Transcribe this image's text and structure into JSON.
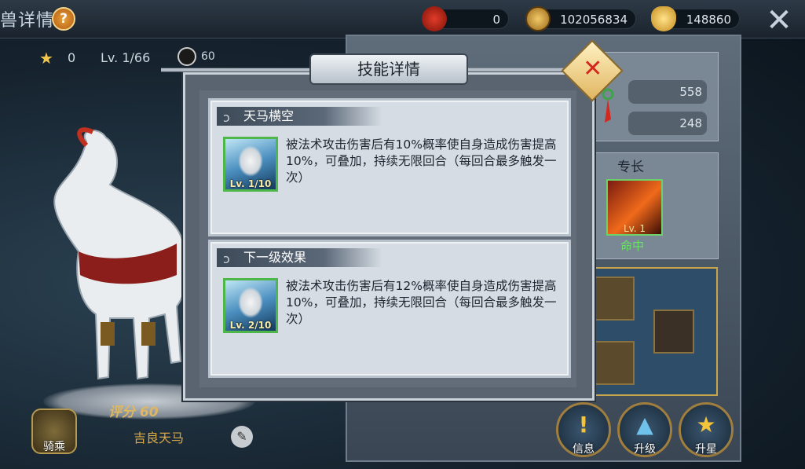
{
  "header": {
    "title": "兽详情",
    "help_label": "?",
    "resources": [
      {
        "icon": "red-gourd-icon",
        "value": "0"
      },
      {
        "icon": "coin-icon",
        "value": "102056834"
      },
      {
        "icon": "gold-ingot-icon",
        "value": "148860"
      }
    ]
  },
  "pet": {
    "stars": "0",
    "level": "Lv. 1/66",
    "spirit": "60",
    "score": "评分 60",
    "name": "吉良天马",
    "mount_label": "骑乘"
  },
  "right_panel": {
    "stat_values": [
      "558",
      "248"
    ],
    "specialty_title": "专长",
    "specialty_level": "Lv. 1",
    "specialty_label": "命中"
  },
  "actions": [
    {
      "name": "info",
      "label": "信息",
      "icon": "exclamation-icon"
    },
    {
      "name": "upgrade",
      "label": "升级",
      "icon": "up-arrow-icon"
    },
    {
      "name": "star-up",
      "label": "升星",
      "icon": "star-icon"
    }
  ],
  "modal": {
    "title": "技能详情",
    "current": {
      "title": "天马横空",
      "level": "Lv. 1/10",
      "description": "被法术攻击伤害后有10%概率使自身造成伤害提高10%，可叠加，持续无限回合（每回合最多触发一次）"
    },
    "next": {
      "title": "下一级效果",
      "level": "Lv. 2/10",
      "description": "被法术攻击伤害后有12%概率使自身造成伤害提高10%，可叠加，持续无限回合（每回合最多触发一次）"
    }
  },
  "colors": {
    "accent_gold": "#c8a44a",
    "highlight_green": "#6be268",
    "close_red": "#d4281e"
  }
}
